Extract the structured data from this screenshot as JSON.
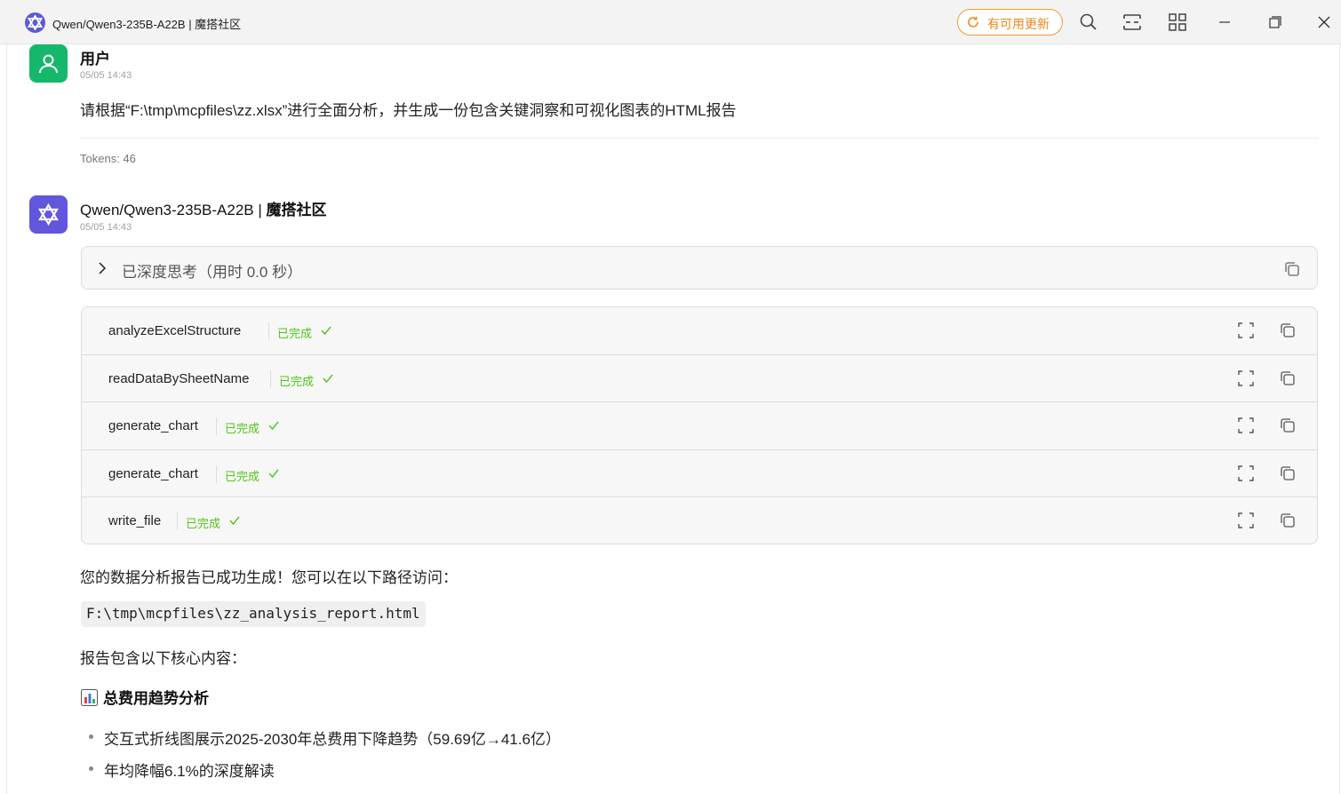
{
  "window": {
    "title": "Qwen/Qwen3-235B-A22B | 魔搭社区",
    "update_label": "有可用更新",
    "toolbar_icons": [
      "search-icon",
      "layout-split-icon",
      "grid-icon"
    ],
    "window_controls": [
      "minimize-icon",
      "maximize-icon",
      "close-icon"
    ],
    "accent_color": "#f0861a"
  },
  "user_message": {
    "sender": "用户",
    "time": "05/05 14:43",
    "text": "请根据“F:\\tmp\\mcpfiles\\zz.xlsx”进行全面分析，并生成一份包含关键洞察和可视化图表的HTML报告",
    "tokens": "Tokens: 46"
  },
  "bot_message": {
    "sender_model": "Qwen/Qwen3-235B-A22B | ",
    "sender_org": "魔搭社区",
    "time": "05/05 14:43",
    "thinking_label": "已深度思考（用时 0.0 秒）",
    "tool_calls": [
      {
        "name": "analyzeExcelStructure",
        "status": "已完成"
      },
      {
        "name": "readDataBySheetName",
        "status": "已完成"
      },
      {
        "name": "generate_chart",
        "status": "已完成"
      },
      {
        "name": "generate_chart",
        "status": "已完成"
      },
      {
        "name": "write_file",
        "status": "已完成"
      }
    ],
    "status_color": "#52c41a",
    "answer_intro": "您的数据分析报告已成功生成！您可以在以下路径访问：",
    "report_path": "F:\\tmp\\mcpfiles\\zz_analysis_report.html",
    "answer_contents": "报告包含以下核心内容：",
    "section_title": "总费用趋势分析",
    "section_items": [
      "交互式折线图展示2025-2030年总费用下降趋势（59.69亿→41.6亿）",
      "年均降幅6.1%的深度解读"
    ]
  }
}
